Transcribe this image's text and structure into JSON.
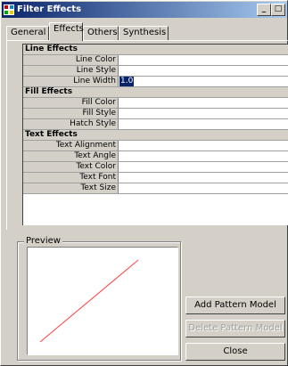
{
  "window": {
    "title": "Filter Effects",
    "minimize_glyph": "_",
    "close_glyph": "□"
  },
  "tabs": [
    {
      "label": "General",
      "active": false
    },
    {
      "label": "Effects",
      "active": true
    },
    {
      "label": "Others",
      "active": false
    },
    {
      "label": "Synthesis",
      "active": false
    }
  ],
  "grid": {
    "sections": [
      {
        "title": "Line Effects",
        "rows": [
          {
            "label": "Line Color",
            "value": ""
          },
          {
            "label": "Line Style",
            "value": ""
          },
          {
            "label": "Line Width",
            "value": "1.0"
          }
        ]
      },
      {
        "title": "Fill Effects",
        "rows": [
          {
            "label": "Fill Color",
            "value": ""
          },
          {
            "label": "Fill Style",
            "value": ""
          },
          {
            "label": "Hatch Style",
            "value": ""
          }
        ]
      },
      {
        "title": "Text Effects",
        "rows": [
          {
            "label": "Text Alignment",
            "value": ""
          },
          {
            "label": "Text Angle",
            "value": ""
          },
          {
            "label": "Text Color",
            "value": ""
          },
          {
            "label": "Text Font",
            "value": ""
          },
          {
            "label": "Text Size",
            "value": ""
          }
        ]
      }
    ]
  },
  "preview": {
    "title": "Preview",
    "line_color": "#ff4040"
  },
  "buttons": {
    "add_pattern": "Add Pattern Model",
    "delete_pattern": "Delete Pattern Model",
    "close": "Close"
  }
}
